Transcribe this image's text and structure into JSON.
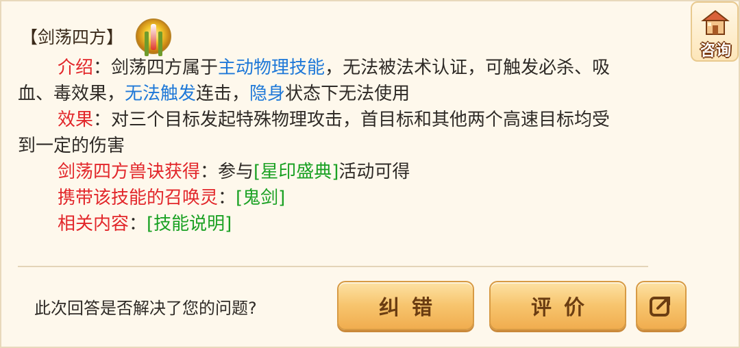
{
  "header": {
    "title": "【剑荡四方】",
    "icon": "skill-sword-icon"
  },
  "consult": {
    "label": "咨询",
    "icon": "house-icon"
  },
  "intro": {
    "label": "介绍",
    "colon": "：",
    "text1": "剑荡四方属于",
    "highlight1": "主动物理技能",
    "text2": "，无法被法术认证，可触发必杀、吸",
    "text3": "血、毒效果，",
    "highlight2": "无法触发",
    "text4": "连击，",
    "highlight3": "隐身",
    "text5": "状态下无法使用"
  },
  "effect": {
    "label": "效果",
    "colon": "：",
    "text1": "对三个目标发起特殊物理攻击，首目标和其他两个高速目标均受",
    "text2": "到一定的伤害"
  },
  "obtain": {
    "label": "剑荡四方兽诀获得",
    "colon": "：",
    "text1": "参与",
    "link": "[星印盛典]",
    "text2": "活动可得"
  },
  "carrier": {
    "label": "携带该技能的召唤灵",
    "colon": "：",
    "link": "[鬼剑]"
  },
  "related": {
    "label": "相关内容",
    "colon": "：",
    "link": "[技能说明]"
  },
  "feedback": {
    "question": "此次回答是否解决了您的问题?",
    "correct_label": "纠错",
    "rate_label": "评价",
    "share_icon": "share-icon"
  },
  "colors": {
    "background": "#fef8ec",
    "label_red": "#e2262a",
    "highlight_blue": "#1e78d8",
    "link_green": "#1aa123",
    "button_gold": "#f7c46d"
  }
}
